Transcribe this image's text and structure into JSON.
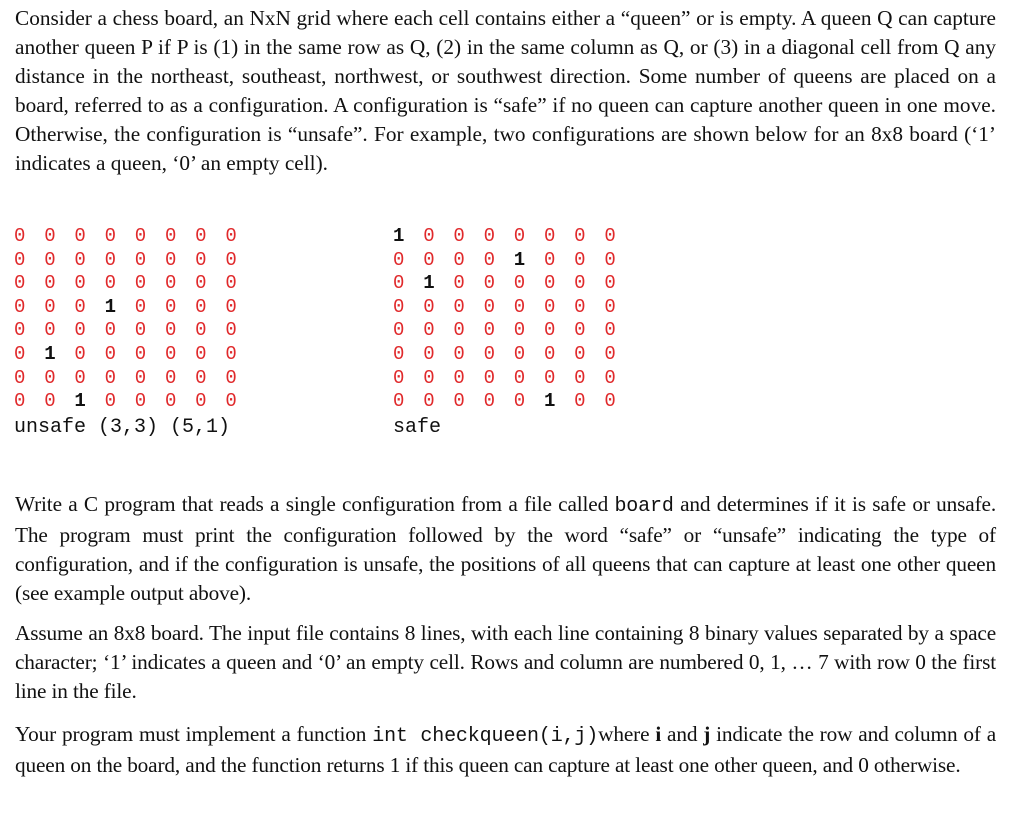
{
  "intro": "Consider a chess board, an NxN grid where each cell contains either a “queen” or is empty. A queen Q can capture another queen P if P is (1) in the same row as Q, (2) in the same column as Q, or (3) in a diagonal cell from Q any distance in the northeast, southeast, northwest, or southwest direction. Some number of queens are placed on a board, referred to as a configuration. A configuration is “safe” if no queen can capture another queen in one move. Otherwise, the configuration is “unsafe”. For example, two configurations are shown below for an 8x8 board (‘1’ indicates a queen, ‘0’ an empty cell).",
  "examples": [
    {
      "grid": [
        [
          0,
          0,
          0,
          0,
          0,
          0,
          0,
          0
        ],
        [
          0,
          0,
          0,
          0,
          0,
          0,
          0,
          0
        ],
        [
          0,
          0,
          0,
          0,
          0,
          0,
          0,
          0
        ],
        [
          0,
          0,
          0,
          1,
          0,
          0,
          0,
          0
        ],
        [
          0,
          0,
          0,
          0,
          0,
          0,
          0,
          0
        ],
        [
          0,
          1,
          0,
          0,
          0,
          0,
          0,
          0
        ],
        [
          0,
          0,
          0,
          0,
          0,
          0,
          0,
          0
        ],
        [
          0,
          0,
          1,
          0,
          0,
          0,
          0,
          0
        ]
      ],
      "verdict": "unsafe (3,3) (5,1)"
    },
    {
      "grid": [
        [
          1,
          0,
          0,
          0,
          0,
          0,
          0,
          0
        ],
        [
          0,
          0,
          0,
          0,
          1,
          0,
          0,
          0
        ],
        [
          0,
          1,
          0,
          0,
          0,
          0,
          0,
          0
        ],
        [
          0,
          0,
          0,
          0,
          0,
          0,
          0,
          0
        ],
        [
          0,
          0,
          0,
          0,
          0,
          0,
          0,
          0
        ],
        [
          0,
          0,
          0,
          0,
          0,
          0,
          0,
          0
        ],
        [
          0,
          0,
          0,
          0,
          0,
          0,
          0,
          0
        ],
        [
          0,
          0,
          0,
          0,
          0,
          1,
          0,
          0
        ]
      ],
      "verdict": "safe"
    }
  ],
  "colors": {
    "empty_cell": "#e0292b",
    "queen_cell": "#111111"
  },
  "task": {
    "p2_before": "Write a C program that reads a single configuration from a file called ",
    "p2_code": "board",
    "p2_after": " and determines if it is safe or unsafe. The program must print the configuration followed by the word “safe” or “unsafe” indicating the type of configuration, and if the configuration is unsafe, the positions of all queens that can capture at least one other queen (see example output above).",
    "p3": "Assume an 8x8 board. The input file contains 8 lines, with each line containing 8 binary values separated by a space character; ‘1’ indicates a queen and ‘0’ an empty cell. Rows and column are numbered 0, 1, … 7 with row 0 the first line in the file.",
    "p4_before": "Your program must implement a function ",
    "p4_code": "int checkqueen(i,j)",
    "p4_mid1": "where ",
    "p4_i": "i",
    "p4_mid2": " and ",
    "p4_j": "j",
    "p4_after": " indicate the row and column of a queen on the board, and the function returns 1 if this queen can capture at least one other queen, and 0 otherwise."
  }
}
